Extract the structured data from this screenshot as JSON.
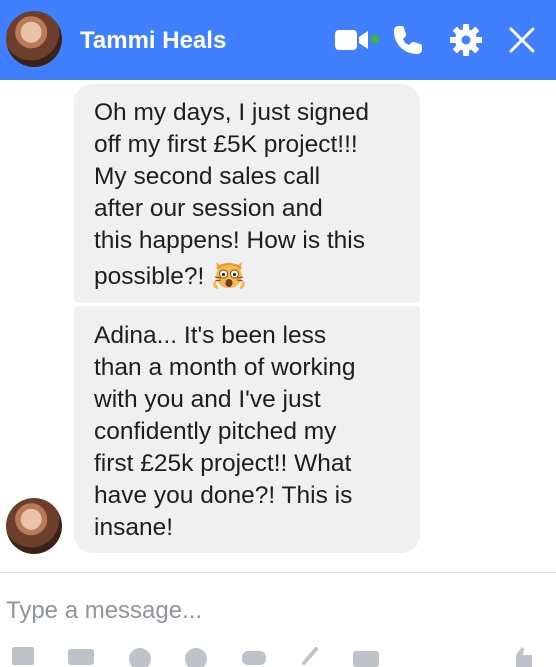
{
  "header": {
    "contact_name": "Tammi Heals",
    "avatar_alt": "Tammi Heals",
    "icons": [
      "video-camera-icon",
      "phone-icon",
      "gear-icon",
      "close-icon"
    ],
    "accent_color": "#4080ff",
    "online_color": "#42b72a"
  },
  "messages": [
    {
      "lines": [
        "Oh my days, I just signed",
        "off my first £5K project!!!",
        "My second sales call",
        "after our session and",
        "this happens! How is this",
        "possible?!"
      ],
      "emoji": "astonished-cat-emoji"
    },
    {
      "lines": [
        "Adina... It's been less",
        "than a month of working",
        "with you and I've just",
        "confidently pitched my",
        "first £25k project!! What",
        "have you done?! This is",
        "insane!"
      ]
    }
  ],
  "composer": {
    "placeholder": "Type a message...",
    "value": ""
  }
}
